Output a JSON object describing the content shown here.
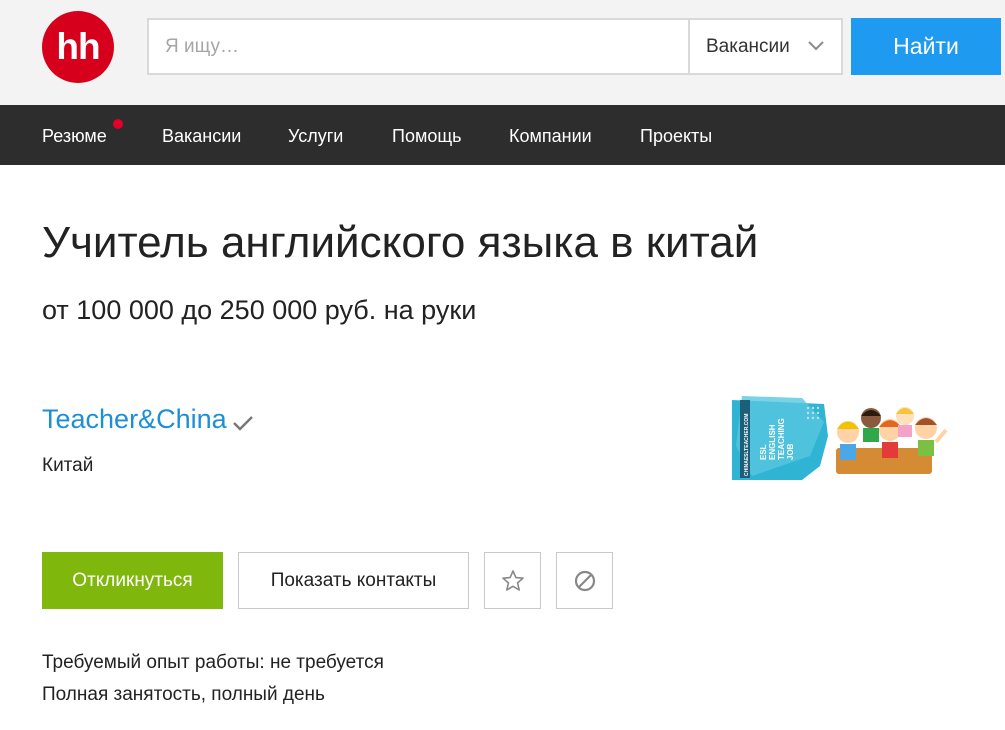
{
  "header": {
    "logo_text": "hh",
    "search": {
      "placeholder": "Я ищу…",
      "value": ""
    },
    "search_type": "Вакансии",
    "find_label": "Найти"
  },
  "nav": {
    "items": [
      "Резюме",
      "Вакансии",
      "Услуги",
      "Помощь",
      "Компании",
      "Проекты"
    ],
    "notification_color": "#e4002b"
  },
  "vacancy": {
    "title": "Учитель английского языка в китай",
    "salary": "от 100 000 до 250 000 руб. на руки",
    "company": "Teacher&China",
    "location": "Китай",
    "experience": "Требуемый опыт работы: не требуется",
    "employment": "Полная занятость, полный день"
  },
  "actions": {
    "respond_label": "Откликнуться",
    "contacts_label": "Показать контакты",
    "favorite_icon": "star-icon",
    "hide_icon": "block-icon"
  },
  "company_logo": {
    "vertical_text": "CHINAESLTEACHER.COM",
    "lines": [
      "ESL",
      "ENGLISH",
      "TEACHING",
      "JOB"
    ]
  },
  "colors": {
    "brand_red": "#d6001c",
    "find_button": "#1e9bf0",
    "nav_bg": "#2d2d2d",
    "respond_button": "#80b70c",
    "company_link": "#1b8fd8"
  }
}
